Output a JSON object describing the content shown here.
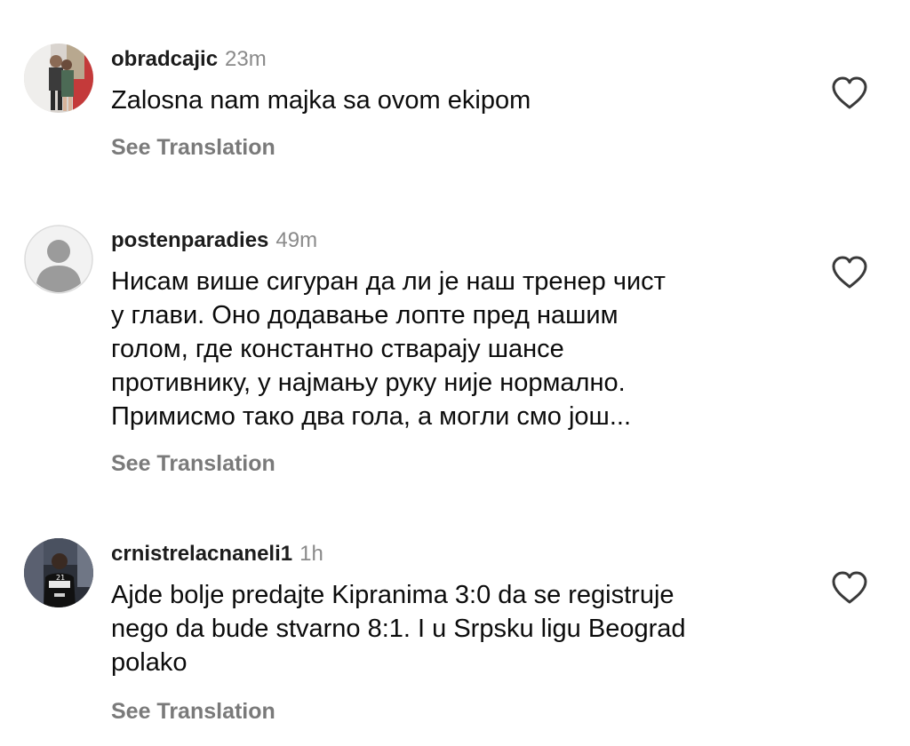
{
  "comments": [
    {
      "username": "obradcajic",
      "time": "23m",
      "lines": [
        "Zalosna nam majka sa ovom ekipom"
      ],
      "translate_label": "See Translation",
      "avatar_icon": "photo-avatar",
      "like_icon": "heart-outline-icon"
    },
    {
      "username": "postenparadies",
      "time": "49m",
      "lines": [
        "Нисам више сигуран да ли је наш тренер чист",
        "у глави. Оно додавање лопте пред нашим",
        "голом, где константно стварају шансе",
        "противнику, у најмању руку није нормално.",
        "Примисмо тако два гола, а могли смо још..."
      ],
      "translate_label": "See Translation",
      "avatar_icon": "default-user-avatar",
      "like_icon": "heart-outline-icon"
    },
    {
      "username": "crnistrelacnaneli1",
      "time": "1h",
      "lines": [
        "Ajde bolje predajte Kipranima 3:0 da se registruje",
        "nego da bude stvarno 8:1. I u Srpsku ligu Beograd",
        "polako"
      ],
      "translate_label": "See Translation",
      "avatar_icon": "photo-avatar",
      "like_icon": "heart-outline-icon"
    }
  ],
  "colors": {
    "username": "#1c1c1c",
    "timestamp": "#8a8a8a",
    "text": "#0c0c0c",
    "translate": "#7a7a7a",
    "heart": "#3a3a3a"
  }
}
